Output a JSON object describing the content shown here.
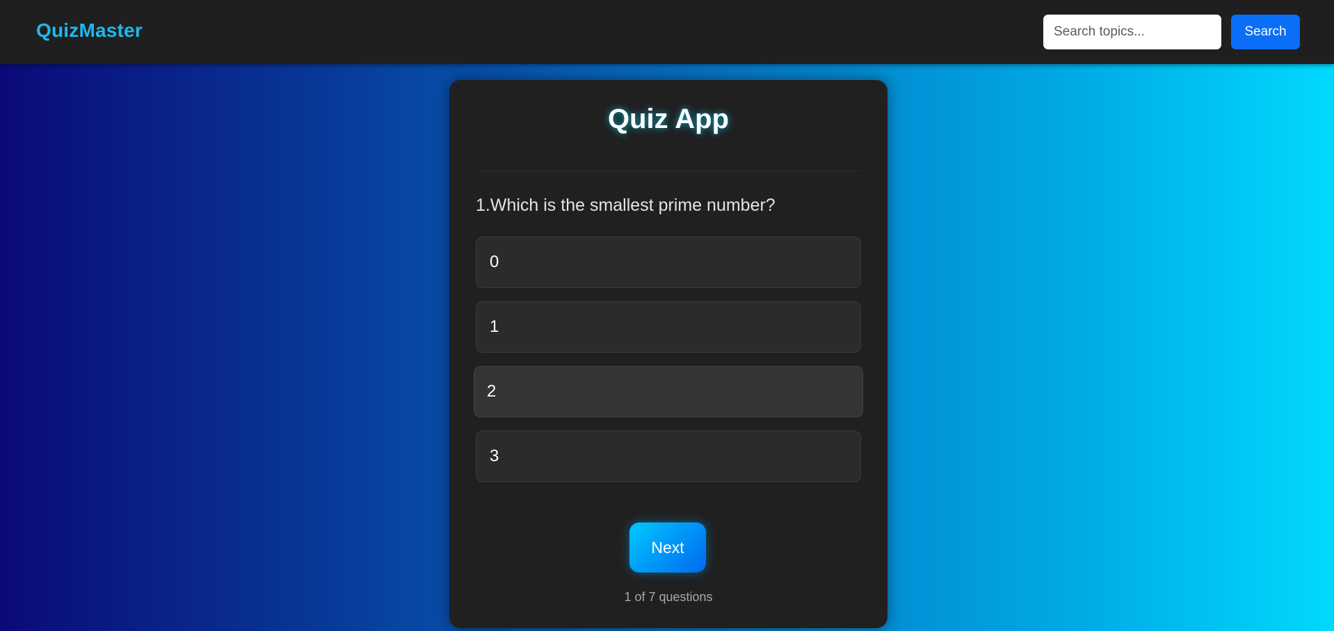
{
  "header": {
    "brand": "QuizMaster",
    "search_placeholder": "Search topics...",
    "search_label": "Search"
  },
  "quiz": {
    "title": "Quiz App",
    "question": "1.Which is the smallest prime number?",
    "options": [
      "0",
      "1",
      "2",
      "3"
    ],
    "next_label": "Next",
    "progress": "1 of 7 questions"
  },
  "colors": {
    "brand": "#1fb8ee",
    "search_button": "#0a6ef6",
    "card_bg": "#202020",
    "navbar_bg": "#1f1f1f"
  }
}
